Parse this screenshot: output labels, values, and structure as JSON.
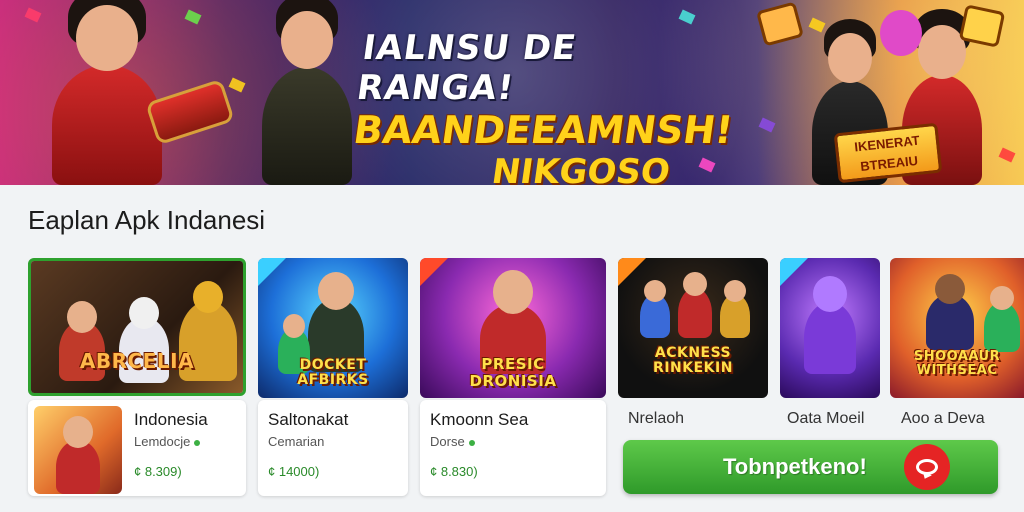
{
  "banner": {
    "line1": "IALNSU DE RANGA!",
    "line2": "BAANDEEAMNSH!",
    "line3": "NIKGOSO",
    "sign_text": "IKENERAT\nBTREAIU"
  },
  "section": {
    "title": "Eaplan Apk Indanesi"
  },
  "cards": [
    {
      "caption": "ABRCELIA",
      "accent": "#2ea12e"
    },
    {
      "caption": "DOCKET\nAFBIRKS",
      "accent": "#1d6fd8"
    },
    {
      "caption": "PRESIC\nDRONISIA",
      "accent": "#b9227a"
    },
    {
      "caption": "ACKNESS\nRINKEKIN",
      "accent": "#1a1a1a"
    },
    {
      "caption": "",
      "accent": "#7a2ad8"
    },
    {
      "caption": "SHOOAAUR\nWITHSEAC",
      "accent": "#e0602a"
    }
  ],
  "featured": {
    "name": "Indonesia",
    "sub": "Lemdocje",
    "price": "¢ 8.309)"
  },
  "items": [
    {
      "name": "Saltonakat",
      "sub": "Cemarian",
      "price": "¢ 14000)"
    },
    {
      "name": "Kmoonn Sea",
      "sub": "Dorse",
      "price": "¢ 8.830)"
    }
  ],
  "plain_labels": [
    "Nrelaoh",
    "Oata Moeil",
    "Aoo a Deva"
  ],
  "cta": {
    "label": "Tobnpetkeno!",
    "icon": "chat-bubble-icon"
  }
}
